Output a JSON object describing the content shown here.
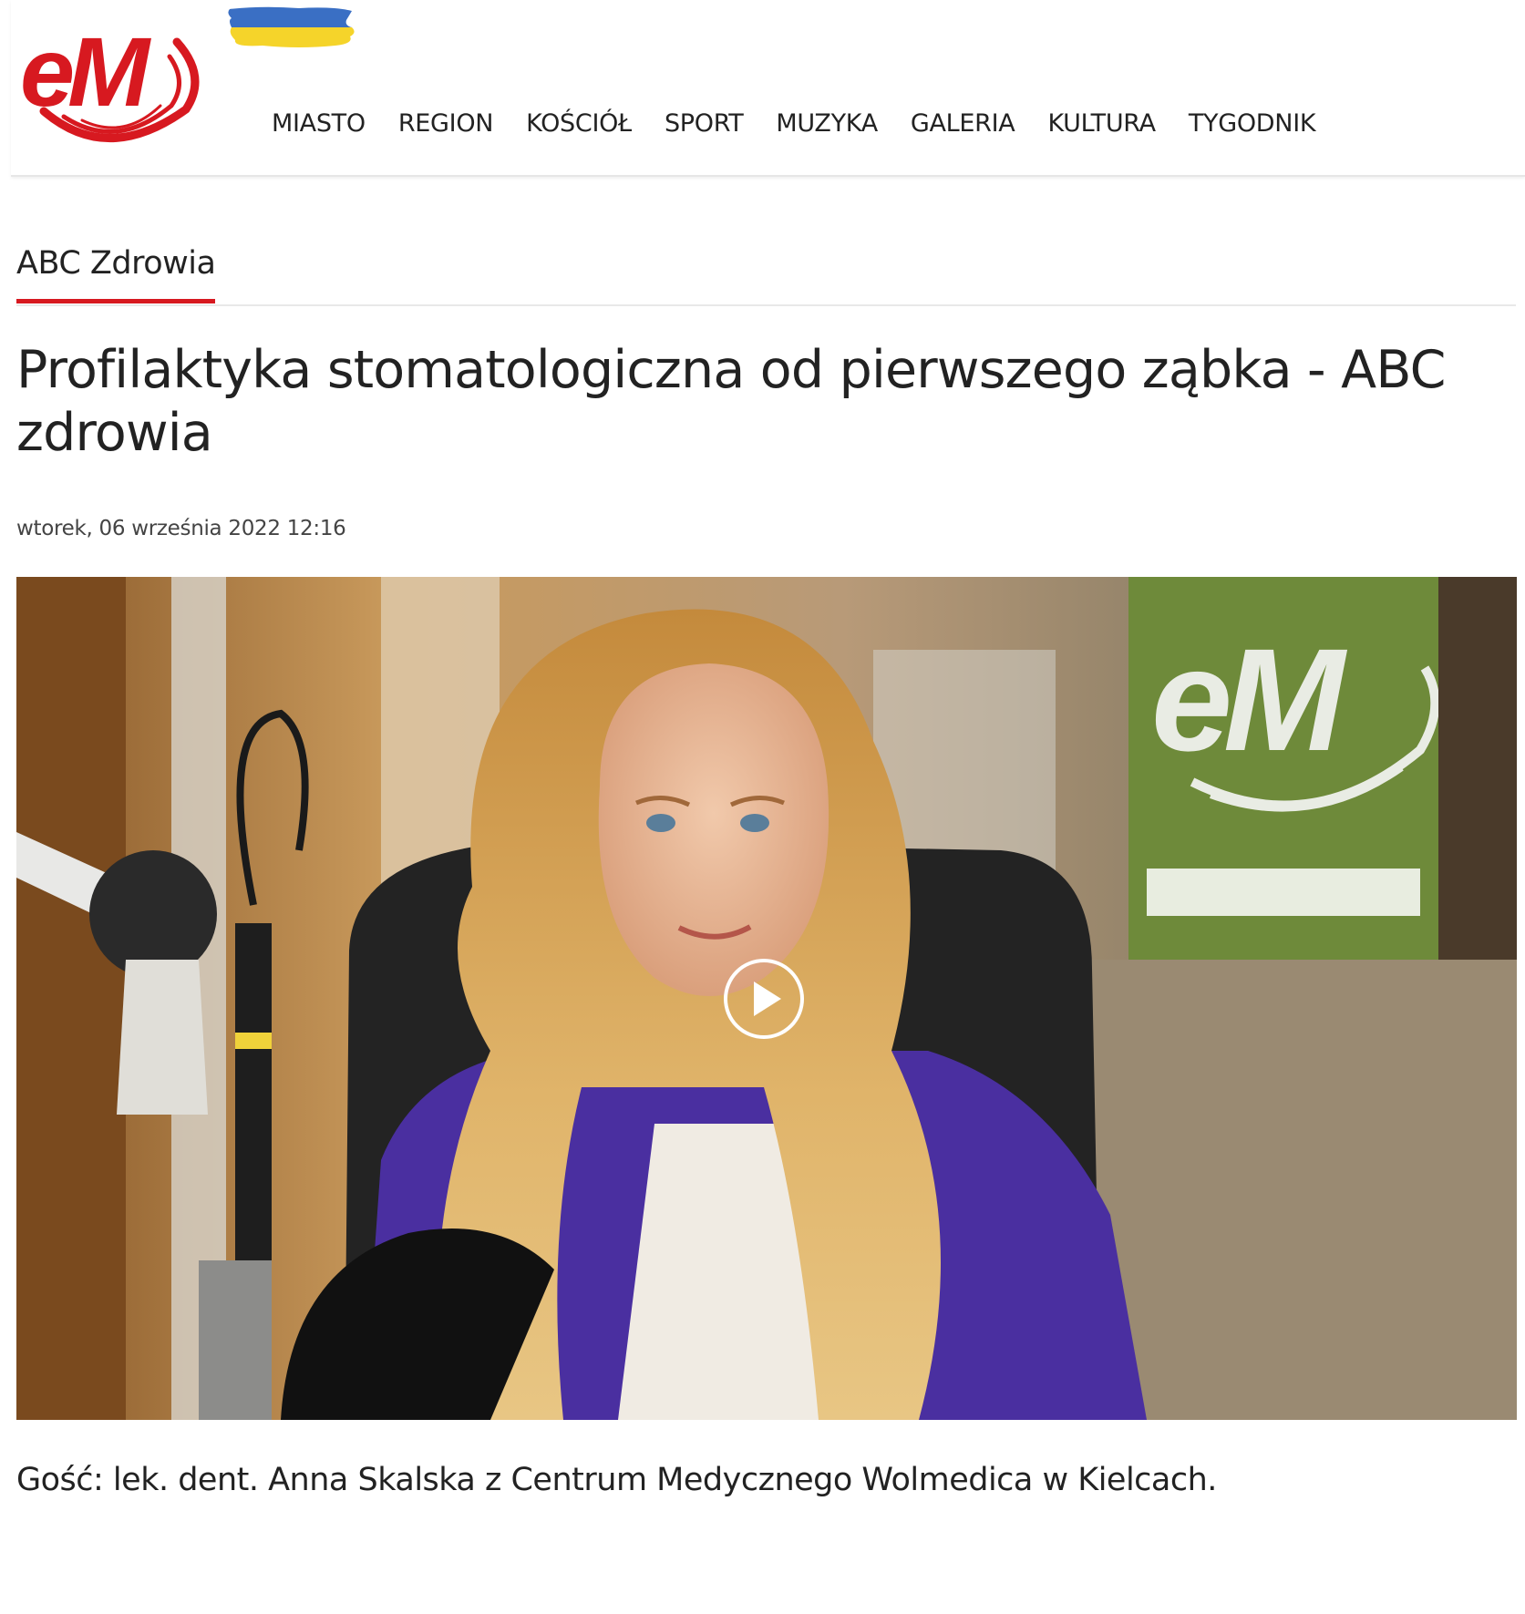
{
  "header": {
    "logo_alt": "eM",
    "nav": [
      "MIASTO",
      "REGION",
      "KOŚCIÓŁ",
      "SPORT",
      "MUZYKA",
      "GALERIA",
      "KULTURA",
      "TYGODNIK"
    ]
  },
  "section": {
    "title": "ABC Zdrowia"
  },
  "article": {
    "title": "Profilaktyka stomatologiczna od pierwszego ząbka - ABC zdrowia",
    "date": "wtorek, 06 września 2022 12:16",
    "caption": "Gość: lek. dent. Anna Skalska z Centrum Medycznego Wolmedica w Kielcach."
  },
  "colors": {
    "brand_red": "#d71920",
    "flag_blue": "#3a6fc4",
    "flag_yellow": "#f5d42a"
  },
  "icons": [
    "em-logo",
    "ukraine-flag-icon",
    "play-icon"
  ]
}
